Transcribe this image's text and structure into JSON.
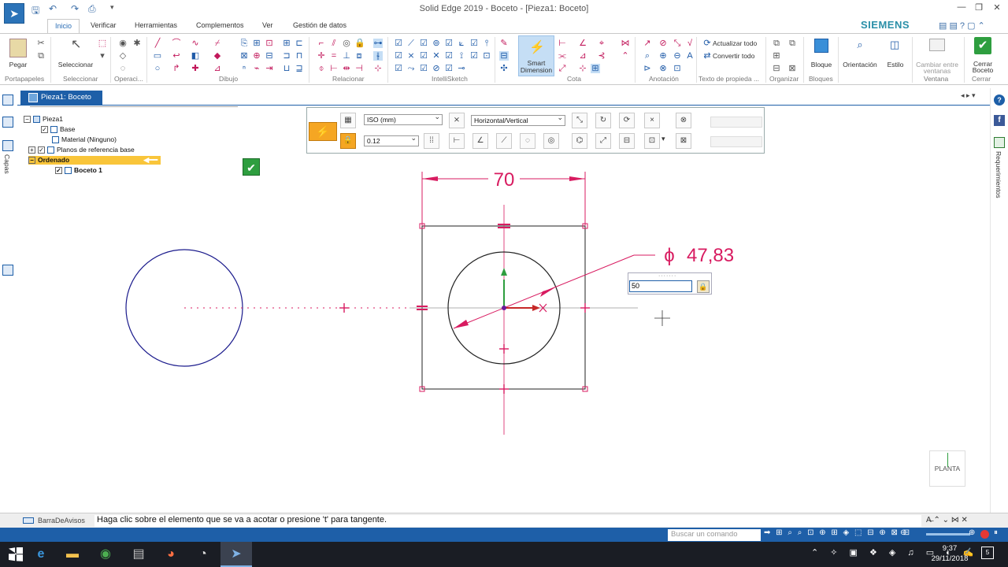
{
  "window": {
    "title": "Solid Edge 2019 - Boceto - [Pieza1: Boceto]",
    "brand": "SIEMENS"
  },
  "ribbon": {
    "tabs": [
      "Inicio",
      "Verificar",
      "Herramientas",
      "Complementos",
      "Ver",
      "Gestión de datos"
    ],
    "active_tab": "Inicio",
    "groups": {
      "portapapeles": "Portapapeles",
      "seleccionar": "Seleccionar",
      "operaciones": "Operaci...",
      "dibujo": "Dibujo",
      "relacionar": "Relacionar",
      "intellisketch": "IntelliSketch",
      "cota": "Cota",
      "anotacion": "Anotación",
      "texto_propiedad": "Texto de propieda ...",
      "organizar": "Organizar",
      "bloques": "Bloques",
      "ventana": "Ventana",
      "cerrar": "Cerrar"
    },
    "buttons": {
      "pegar": "Pegar",
      "seleccionar": "Seleccionar",
      "smart_dimension_1": "Smart",
      "smart_dimension_2": "Dimension",
      "actualizar_todo": "Actualizar todo",
      "convertir_todo": "Convertir todo",
      "bloque": "Bloque",
      "orientacion": "Orientación",
      "estilo": "Estilo",
      "cambiar_ventanas_1": "Cambiar entre",
      "cambiar_ventanas_2": "ventanas",
      "cerrar_boceto_1": "Cerrar",
      "cerrar_boceto_2": "Boceto"
    }
  },
  "document_tab": "Pieza1: Boceto",
  "side_panels": {
    "left": "Capas",
    "right": "Requerimientos"
  },
  "pathfinder": {
    "items": [
      {
        "label": "Pieza1"
      },
      {
        "label": "Base"
      },
      {
        "label": "Material (Ninguno)"
      },
      {
        "label": "Planos de referencia base"
      },
      {
        "label": "Ordenado"
      },
      {
        "label": "Boceto 1"
      }
    ]
  },
  "command_bar": {
    "standard": "ISO (mm)",
    "orientation": "Horizontal/Vertical",
    "tolerance": "0.12"
  },
  "sketch": {
    "width_dimension": "70",
    "diameter_symbol": "ϕ",
    "diameter_value": "47,83",
    "dimension_color": "#d81b60",
    "curve_color": "#1a1a8c",
    "input_value": "50"
  },
  "view_cube_label": "PLANTA",
  "status": {
    "bar_label": "BarraDeAvisos",
    "message": "Haga clic sobre el elemento que se va a acotar o presione 't' para tangente.",
    "search_placeholder": "Buscar un comando"
  },
  "clock": {
    "time": "9:37",
    "date": "29/11/2018",
    "notifications": "5"
  }
}
